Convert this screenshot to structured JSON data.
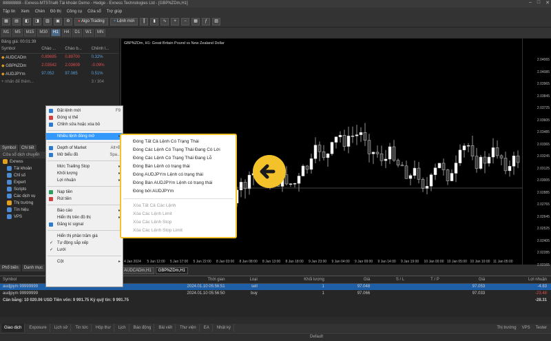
{
  "window": {
    "title": "88888888 - Exness-MT5Trial6 Tài khoản Demo - Hedge - Exness Technologies Ltd - [GBPNZDm,H1]"
  },
  "menu": [
    "Tập tin",
    "Xem",
    "Chèn",
    "Đồ thị",
    "Công cụ",
    "Cửa sổ",
    "Trợ giúp"
  ],
  "toolbar": {
    "algo_trading": "Algo Trading",
    "new_order": "Lệnh mới"
  },
  "timeframes": [
    "M1",
    "M5",
    "M15",
    "M30",
    "H1",
    "H4",
    "D1",
    "W1",
    "MN"
  ],
  "timeframe_active": "H1",
  "market_watch": {
    "header": "Bảng giá: 00:01:39",
    "columns": [
      "Symbol",
      "Chào ...",
      "Chào b...",
      "Chênh l..."
    ],
    "rows": [
      {
        "symbol": "AUDCADm",
        "bid": "0.89695",
        "ask": "0.89700",
        "change": "0.32%"
      },
      {
        "symbol": "GBPNZDm",
        "bid": "2.03542",
        "ask": "2.03609",
        "change": "-0.09%"
      },
      {
        "symbol": "AUDJPYm",
        "bid": "97.052",
        "ask": "97.065",
        "change": "0.51%"
      }
    ],
    "add_row": "+ nhấn để thêm...",
    "count": "3 / 304"
  },
  "navigator": {
    "tabs": [
      "Symbol",
      "Chi tiết"
    ],
    "header": "Cửa sổ dịch chuyển",
    "items": [
      "Exness",
      "Tài khoản",
      "Chỉ số",
      "Expert",
      "Scripts",
      "Các dịch vụ",
      "Thị trường",
      "Tín hiệu",
      "VPS"
    ],
    "bottom_tabs": [
      "Phổ biến",
      "Danh mục"
    ]
  },
  "chart": {
    "title": "GBPNZDm, H1: Great Britain Pound vs New Zealand Dollar",
    "y_ticks": [
      "2.04065",
      "2.04085",
      "2.03965",
      "2.03845",
      "2.03725",
      "2.03605",
      "2.03485",
      "2.03365",
      "2.03245",
      "2.03125",
      "2.03005",
      "2.02885",
      "2.02765",
      "2.02645",
      "2.02525",
      "2.02405",
      "2.02285",
      "2.02165"
    ],
    "x_ticks": [
      "4 Jan 2024",
      "5 Jan 12:00",
      "5 Jan 17:00",
      "5 Jan 22:00",
      "8 Jan 03:00",
      "8 Jan 08:00",
      "8 Jan 13:00",
      "8 Jan 18:00",
      "9 Jan 23:00",
      "9 Jan 04:00",
      "9 Jan 09:00",
      "9 Jan 14:00",
      "9 Jan 19:00",
      "10 Jan 00:00",
      "10 Jan 05:00",
      "10 Jan 10:00",
      "11 Jan 05:00"
    ],
    "tabs": [
      "AUDCADm,H1",
      "GBPNZDm,H1"
    ]
  },
  "context_menu": {
    "items": [
      {
        "label": "Đặt lệnh mới",
        "shortcut": "F9"
      },
      {
        "label": "Đóng vị thế",
        "shortcut": ""
      },
      {
        "label": "Chỉnh sửa hoặc xóa bỏ",
        "shortcut": ""
      },
      {
        "label": "Nhiều lệnh đóng mở",
        "shortcut": "",
        "selected": true,
        "submenu": true
      },
      {
        "label": "Depth of Market",
        "shortcut": "Alt+B"
      },
      {
        "label": "Mở biểu đồ",
        "shortcut": "Spa..."
      },
      {
        "label": "Mức Trailing Stop",
        "submenu": true
      },
      {
        "label": "Khối lượng",
        "submenu": true
      },
      {
        "label": "Lợi nhuận",
        "submenu": true
      },
      {
        "label": "Nạp tiền",
        "shortcut": ""
      },
      {
        "label": "Rút tiền",
        "shortcut": ""
      },
      {
        "label": "Báo cáo",
        "submenu": true
      },
      {
        "label": "Hiển thị trên đồ thị",
        "submenu": true
      },
      {
        "label": "Đăng kí signal",
        "shortcut": ""
      },
      {
        "label": "Hiển thị phần trăm giá",
        "shortcut": ""
      },
      {
        "label": "Tự động sắp xếp",
        "shortcut": ""
      },
      {
        "label": "Lưới",
        "shortcut": ""
      },
      {
        "label": "Cột",
        "submenu": true
      }
    ]
  },
  "submenu": {
    "items": [
      "Đóng Tất Cả Lệnh Có Trạng Thái",
      "Đóng Các Lệnh Có Trạng Thái Đang Có Lời",
      "Đóng Các Lệnh Có Trạng Thái Đang Lỗ",
      "Đóng Bán Lệnh có trạng thái",
      "Đóng AUDJPYm Lệnh có trạng thái",
      "Đóng Bán AUDJPYm Lệnh có trạng thái",
      "Đóng bởi AUDJPYm"
    ],
    "disabled_items": [
      "Xóa Tất Cả Các Lệnh",
      "Xóa Các Lệnh Limit",
      "Xóa Các Lệnh Stop",
      "Xóa Các Lệnh Stop Limit"
    ]
  },
  "terminal": {
    "columns": [
      "Symbol",
      "Thời gian",
      "Loại",
      "Khối lượng",
      "Giá",
      "S / L",
      "T / P",
      "Giá",
      "Lợi nhuận"
    ],
    "rows": [
      {
        "symbol": "audjpym",
        "ticket": "99999999",
        "time": "2024.01.10 05:56:51",
        "type": "sell",
        "volume": "1",
        "price": "97.048",
        "sl": "",
        "tp": "",
        "cur_price": "97.053",
        "profit": "-4.83"
      },
      {
        "symbol": "audjpym",
        "ticket": "99999999",
        "time": "2024.01.10 05:56:50",
        "type": "buy",
        "volume": "1",
        "price": "97.066",
        "sl": "",
        "tp": "",
        "cur_price": "97.033",
        "profit": "-23.48"
      }
    ],
    "balance_line": "Cân bằng: 10 020.06 USD  Tiền vốn: 9 991.75  Ký quỹ tin: 9 991.75",
    "total_profit": "-28.31"
  },
  "bottom_tabs": [
    "Giao dịch",
    "Exposure",
    "Lịch sử",
    "Tin tức",
    "Hộp thư",
    "Lịch",
    "Báo động",
    "Bài viết",
    "Thư viện",
    "EA",
    "Nhật ký"
  ],
  "bottom_right": [
    "Thị trường",
    "VPS",
    "Tester"
  ],
  "status": {
    "default": "Default"
  },
  "colors": {
    "highlight": "#f3c22b",
    "bull": "#ffffff",
    "bear": "#3a3a3a"
  }
}
